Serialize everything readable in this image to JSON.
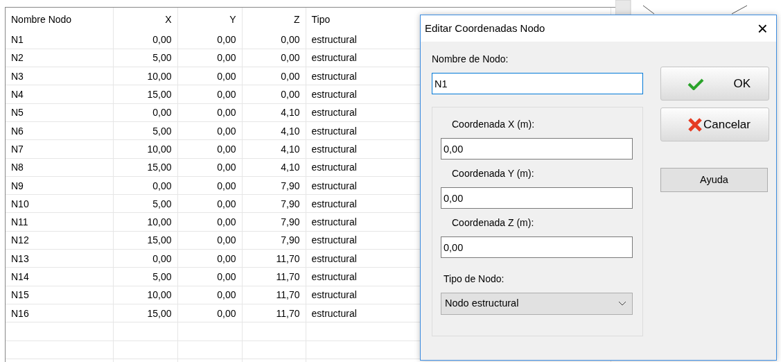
{
  "table": {
    "columns": [
      {
        "label": "Nombre Nodo"
      },
      {
        "label": "X"
      },
      {
        "label": "Y"
      },
      {
        "label": "Z"
      },
      {
        "label": "Tipo"
      }
    ],
    "rows": [
      [
        "N1",
        "0,00",
        "0,00",
        "0,00",
        "estructural"
      ],
      [
        "N2",
        "5,00",
        "0,00",
        "0,00",
        "estructural"
      ],
      [
        "N3",
        "10,00",
        "0,00",
        "0,00",
        "estructural"
      ],
      [
        "N4",
        "15,00",
        "0,00",
        "0,00",
        "estructural"
      ],
      [
        "N5",
        "0,00",
        "0,00",
        "4,10",
        "estructural"
      ],
      [
        "N6",
        "5,00",
        "0,00",
        "4,10",
        "estructural"
      ],
      [
        "N7",
        "10,00",
        "0,00",
        "4,10",
        "estructural"
      ],
      [
        "N8",
        "15,00",
        "0,00",
        "4,10",
        "estructural"
      ],
      [
        "N9",
        "0,00",
        "0,00",
        "7,90",
        "estructural"
      ],
      [
        "N10",
        "5,00",
        "0,00",
        "7,90",
        "estructural"
      ],
      [
        "N11",
        "10,00",
        "0,00",
        "7,90",
        "estructural"
      ],
      [
        "N12",
        "15,00",
        "0,00",
        "7,90",
        "estructural"
      ],
      [
        "N13",
        "0,00",
        "0,00",
        "11,70",
        "estructural"
      ],
      [
        "N14",
        "5,00",
        "0,00",
        "11,70",
        "estructural"
      ],
      [
        "N15",
        "10,00",
        "0,00",
        "11,70",
        "estructural"
      ],
      [
        "N16",
        "15,00",
        "0,00",
        "11,70",
        "estructural"
      ]
    ]
  },
  "dialog": {
    "title": "Editar Coordenadas Nodo",
    "close": "×",
    "name_label": "Nombre de Nodo:",
    "name_value": "N1",
    "coordinates": [
      {
        "label": "Coordenada X (m):",
        "value": "0,00"
      },
      {
        "label": "Coordenada Y (m):",
        "value": "0,00"
      },
      {
        "label": "Coordenada Z (m):",
        "value": "0,00"
      }
    ],
    "type_label": "Tipo de Nodo:",
    "type_value": "Nodo estructural",
    "buttons": [
      {
        "label": "OK",
        "kind": "ok"
      },
      {
        "label": "Cancelar",
        "kind": "cancel"
      },
      {
        "label": "Ayuda",
        "kind": "plain"
      }
    ]
  }
}
